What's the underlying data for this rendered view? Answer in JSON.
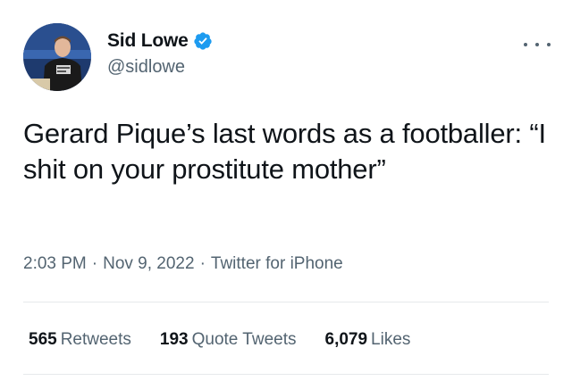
{
  "author": {
    "display_name": "Sid Lowe",
    "handle": "@sidlowe",
    "verified_icon": "verified-badge-icon",
    "avatar_icon": "profile-photo",
    "verified_color": "#1d9bf0"
  },
  "tweet": {
    "text": "Gerard Pique’s last words as a footballer: “I shit on your prostitute mother”"
  },
  "meta": {
    "time": "2:03 PM",
    "date": "Nov 9, 2022",
    "source": "Twitter for iPhone",
    "separator": "·"
  },
  "stats": {
    "retweets_count": "565",
    "retweets_label": "Retweets",
    "quotes_count": "193",
    "quotes_label": "Quote Tweets",
    "likes_count": "6,079",
    "likes_label": "Likes"
  },
  "more_icon": "more-options-icon"
}
